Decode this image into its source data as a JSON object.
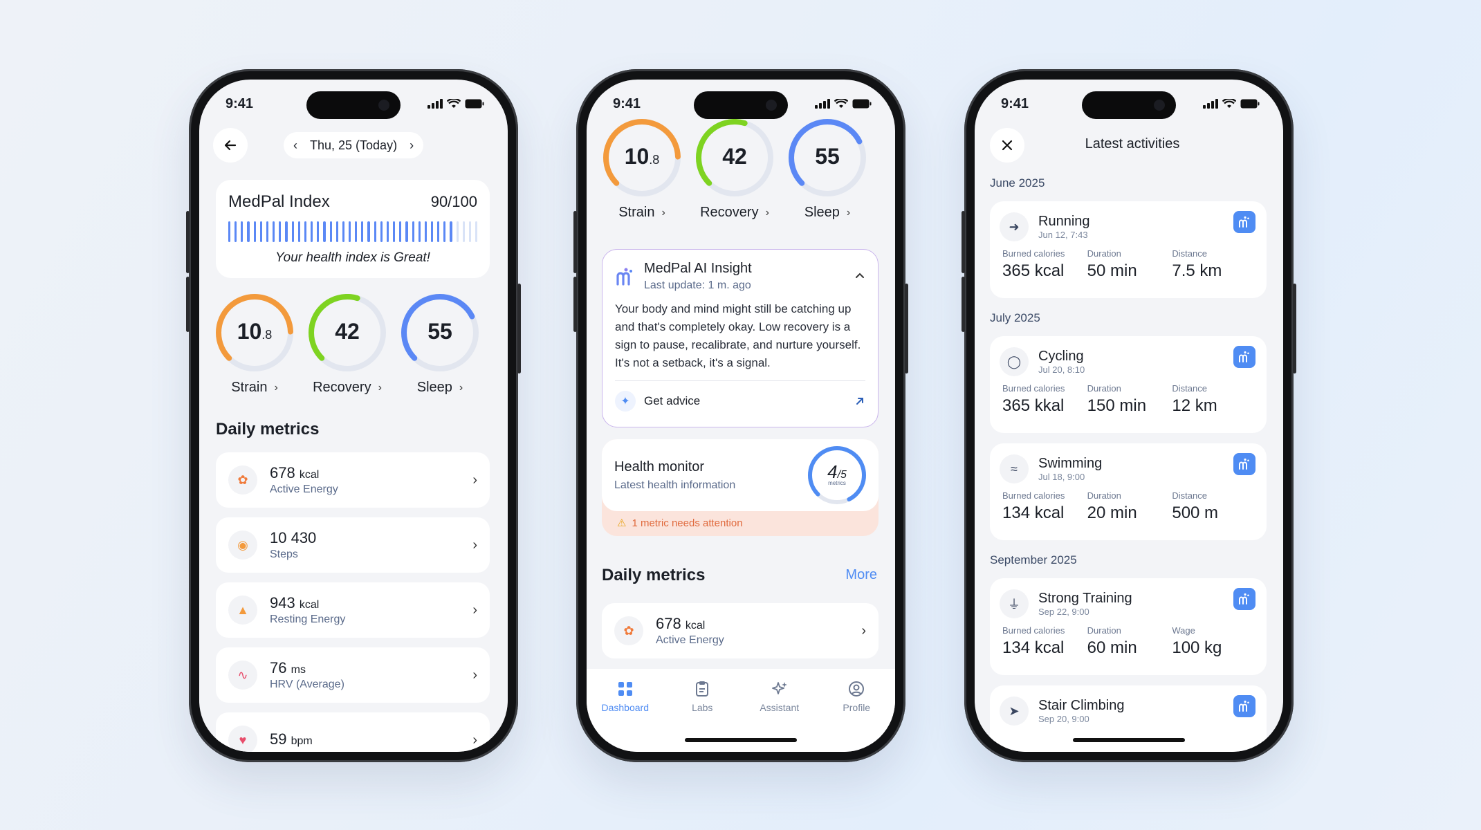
{
  "status": {
    "time": "9:41"
  },
  "phone1": {
    "date_label": "Thu, 25 (Today)",
    "index_title": "MedPal Index",
    "index_score": "90/100",
    "index_bars_filled": 0.9,
    "index_caption": "Your health index is Great!",
    "rings": [
      {
        "value": "10",
        "decimal": ".8",
        "label": "Strain",
        "color": "#f39a3c",
        "fraction": 0.62
      },
      {
        "value": "42",
        "decimal": "",
        "label": "Recovery",
        "color": "#7ed321",
        "fraction": 0.42
      },
      {
        "value": "55",
        "decimal": "",
        "label": "Sleep",
        "color": "#5b88f5",
        "fraction": 0.55
      }
    ],
    "daily_title": "Daily metrics",
    "metrics": [
      {
        "value": "678",
        "unit": "kcal",
        "label": "Active Energy",
        "icon": "flame-run-icon",
        "icon_color": "#f07a3a"
      },
      {
        "value": "10 430",
        "unit": "",
        "label": "Steps",
        "icon": "footprints-icon",
        "icon_color": "#f39a3c"
      },
      {
        "value": "943",
        "unit": "kcal",
        "label": "Resting Energy",
        "icon": "flame-icon",
        "icon_color": "#f39a3c"
      },
      {
        "value": "76",
        "unit": "ms",
        "label": "HRV (Average)",
        "icon": "heartbeat-icon",
        "icon_color": "#e84d6b"
      },
      {
        "value": "59",
        "unit": "bpm",
        "label": "",
        "icon": "heart-icon",
        "icon_color": "#e84d6b"
      }
    ]
  },
  "phone2": {
    "rings": [
      {
        "value": "10",
        "decimal": ".8",
        "label": "Strain",
        "color": "#f39a3c",
        "fraction": 0.62
      },
      {
        "value": "42",
        "decimal": "",
        "label": "Recovery",
        "color": "#7ed321",
        "fraction": 0.42
      },
      {
        "value": "55",
        "decimal": "",
        "label": "Sleep",
        "color": "#5b88f5",
        "fraction": 0.55
      }
    ],
    "insight": {
      "title": "MedPal AI Insight",
      "subtitle": "Last update: 1 m. ago",
      "body": "Your body and mind might still be catching up and that's completely okay. Low recovery is a sign to pause, recalibrate, and nurture yourself. It's not a setback, it's a signal.",
      "advice": "Get advice"
    },
    "monitor": {
      "title": "Health monitor",
      "subtitle": "Latest health information",
      "count": "4",
      "total": "/5",
      "unit": "metrics",
      "fraction": 0.8,
      "alert": "1 metric needs attention"
    },
    "daily_title": "Daily metrics",
    "more_label": "More",
    "metric": {
      "value": "678",
      "unit": "kcal",
      "label": "Active Energy"
    },
    "tabs": [
      {
        "label": "Dashboard",
        "icon": "grid-icon",
        "active": true
      },
      {
        "label": "Labs",
        "icon": "clipboard-icon",
        "active": false
      },
      {
        "label": "Assistant",
        "icon": "sparkle-icon",
        "active": false
      },
      {
        "label": "Profile",
        "icon": "user-circle-icon",
        "active": false
      }
    ]
  },
  "phone3": {
    "title": "Latest activities",
    "groups": [
      {
        "month": "June 2025",
        "items": [
          {
            "name": "Running",
            "date": "Jun 12, 7:43",
            "icon": "running-icon",
            "stats": [
              {
                "label": "Burned calories",
                "value": "365 kcal"
              },
              {
                "label": "Duration",
                "value": "50 min"
              },
              {
                "label": "Distance",
                "value": "7.5 km"
              }
            ]
          }
        ]
      },
      {
        "month": "July 2025",
        "items": [
          {
            "name": "Cycling",
            "date": "Jul 20, 8:10",
            "icon": "bike-icon",
            "stats": [
              {
                "label": "Burned calories",
                "value": "365 kkal"
              },
              {
                "label": "Duration",
                "value": "150 min"
              },
              {
                "label": "Distance",
                "value": "12 km"
              }
            ]
          },
          {
            "name": "Swimming",
            "date": "Jul 18, 9:00",
            "icon": "swim-icon",
            "stats": [
              {
                "label": "Burned calories",
                "value": "134 kcal"
              },
              {
                "label": "Duration",
                "value": "20 min"
              },
              {
                "label": "Distance",
                "value": "500 m"
              }
            ]
          }
        ]
      },
      {
        "month": "September 2025",
        "items": [
          {
            "name": "Strong Training",
            "date": "Sep 22, 9:00",
            "icon": "weightlift-icon",
            "stats": [
              {
                "label": "Burned calories",
                "value": "134 kcal"
              },
              {
                "label": "Duration",
                "value": "60 min"
              },
              {
                "label": "Wage",
                "value": "100 kg"
              }
            ]
          },
          {
            "name": "Stair Climbing",
            "date": "Sep 20, 9:00",
            "icon": "stairs-icon",
            "stats": []
          }
        ]
      }
    ]
  }
}
